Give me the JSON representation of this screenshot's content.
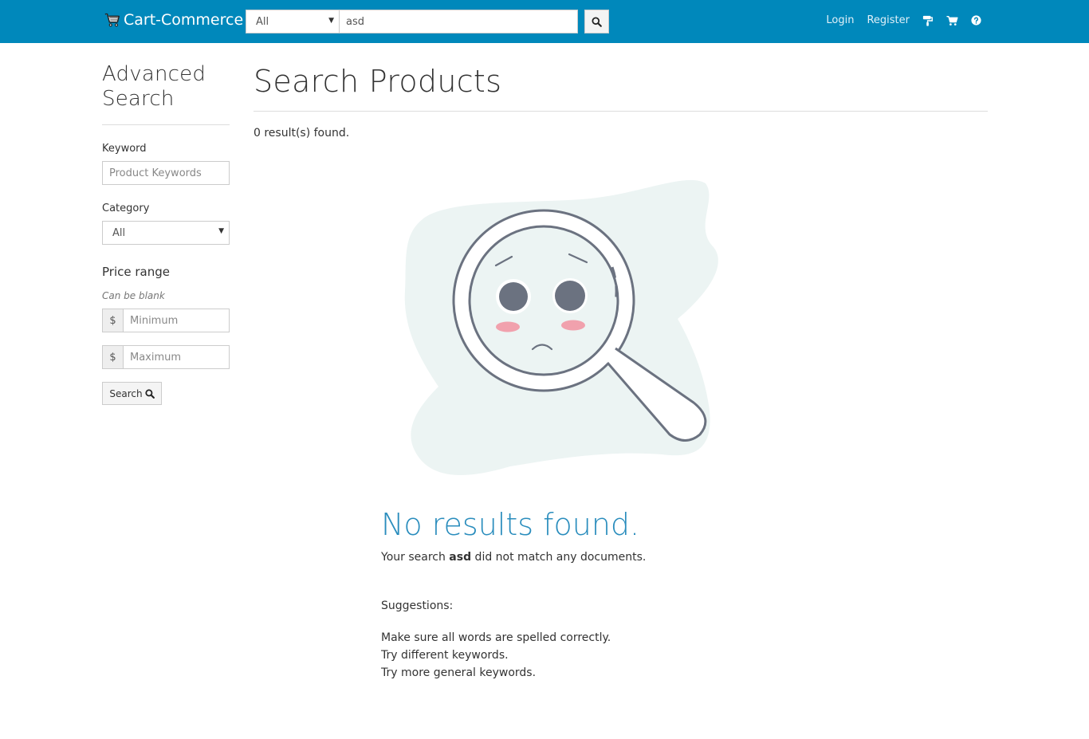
{
  "navbar": {
    "brand": "Cart-Commerce",
    "category_value": "All",
    "search_value": "asd",
    "links": {
      "login": "Login",
      "register": "Register"
    },
    "icons": [
      "cart-logo-icon",
      "search-icon",
      "paint-roller-icon",
      "shopping-cart-icon",
      "question-circle-icon"
    ],
    "color": "#0088bb"
  },
  "sidebar": {
    "title": "Advanced Search",
    "keyword_label": "Keyword",
    "keyword_placeholder": "Product Keywords",
    "category_label": "Category",
    "category_value": "All",
    "price_heading": "Price range",
    "price_hint": "Can be blank",
    "currency": "$",
    "min_placeholder": "Minimum",
    "max_placeholder": "Maximum",
    "search_button": "Search"
  },
  "main": {
    "title": "Search Products",
    "result_count": "0 result(s) found.",
    "no_results_title": "No results found.",
    "no_results_prefix": "Your search ",
    "query": "asd",
    "no_results_suffix": " did not match any documents.",
    "suggestions_title": "Suggestions:",
    "suggestions": [
      "Make sure all words are spelled correctly.",
      "Try different keywords.",
      "Try more general keywords."
    ],
    "accent_color": "#2a8dbd"
  }
}
